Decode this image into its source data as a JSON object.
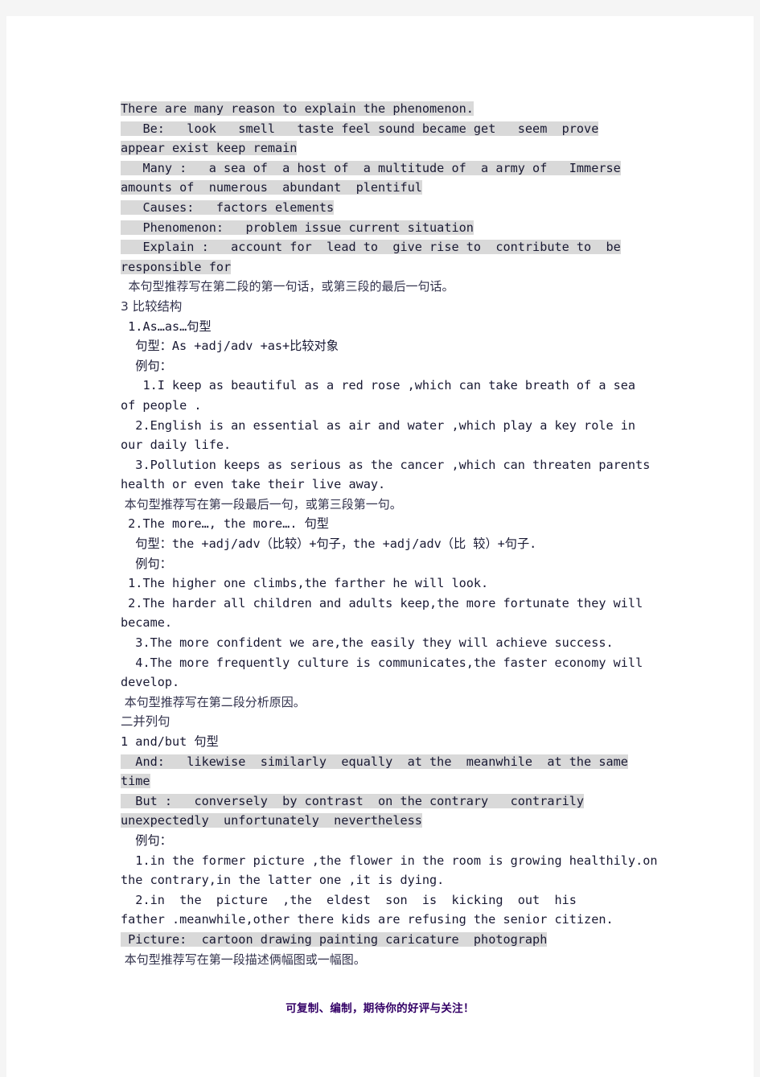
{
  "document": {
    "colors": {
      "page_background": "#f5f5f5",
      "paper": "#ffffff",
      "text": "#191933",
      "chinese_text": "#33334d",
      "highlight": "#d9d9d9",
      "footer": "#330066"
    },
    "body": {
      "l01": "There are many reason to explain the phenomenon.",
      "l02": "   Be:   look   smell   taste feel sound became get   seem  prove",
      "l03": "appear exist keep remain",
      "l04": "   Many :   a sea of  a host of  a multitude of  a army of   Immerse",
      "l05": "amounts of  numerous  abundant  plentiful",
      "l06": "   Causes:   factors elements",
      "l07": "   Phenomenon:   problem issue current situation",
      "l08": "   Explain :   account for  lead to  give rise to  contribute to  be",
      "l09": "responsible for",
      "l10": "  本句型推荐写在第二段的第一句话，或第三段的最后一句话。",
      "l11": "3 比较结构",
      "l12": " 1.As…as…句型",
      "l13": "  句型：As +adj/adv +as+比较对象",
      "l14": "  例句：",
      "l15": "   1.I keep as beautiful as a red rose ,which can take breath of a sea",
      "l16": "of people .",
      "l17": "  2.English is an essential as air and water ,which play a key role in",
      "l18": "our daily life.",
      "l19": "  3.Pollution keeps as serious as the cancer ,which can threaten parents",
      "l20": "health or even take their live away.",
      "l21": " 本句型推荐写在第一段最后一句，或第三段第一句。",
      "l22": " 2.The more…, the more…. 句型",
      "l23": "  句型：the +adj/adv（比较）+句子，the +adj/adv（比 较）+句子.",
      "l24": "  例句：",
      "l25": " 1.The higher one climbs,the farther he will look.",
      "l26": " 2.The harder all children and adults keep,the more fortunate they will",
      "l27": "became.",
      "l28": "  3.The more confident we are,the easily they will achieve success.",
      "l29": "  4.The more frequently culture is communicates,the faster economy will",
      "l30": "develop.",
      "l31": " 本句型推荐写在第二段分析原因。",
      "l32": "二并列句",
      "l33": "1 and/but 句型",
      "l34": "  And:   likewise  similarly  equally  at the  meanwhile  at the same",
      "l35": "time",
      "l36": "  But :   conversely  by contrast  on the contrary   contrarily",
      "l37": "unexpectedly  unfortunately  nevertheless",
      "l38": "  例句：",
      "l39": "  1.in the former picture ,the flower in the room is growing healthily.on",
      "l40": "the contrary,in the latter one ,it is dying.",
      "l41": "  2.in  the  picture  ,the  eldest  son  is  kicking  out  his",
      "l42": "father .meanwhile,other there kids are refusing the senior citizen.",
      "l43": " Picture:  cartoon drawing painting caricature  photograph",
      "l44": " 本句型推荐写在第一段描述俩幅图或一幅图。"
    },
    "footer": {
      "text": "可复制、编制，期待你的好评与关注！"
    }
  }
}
